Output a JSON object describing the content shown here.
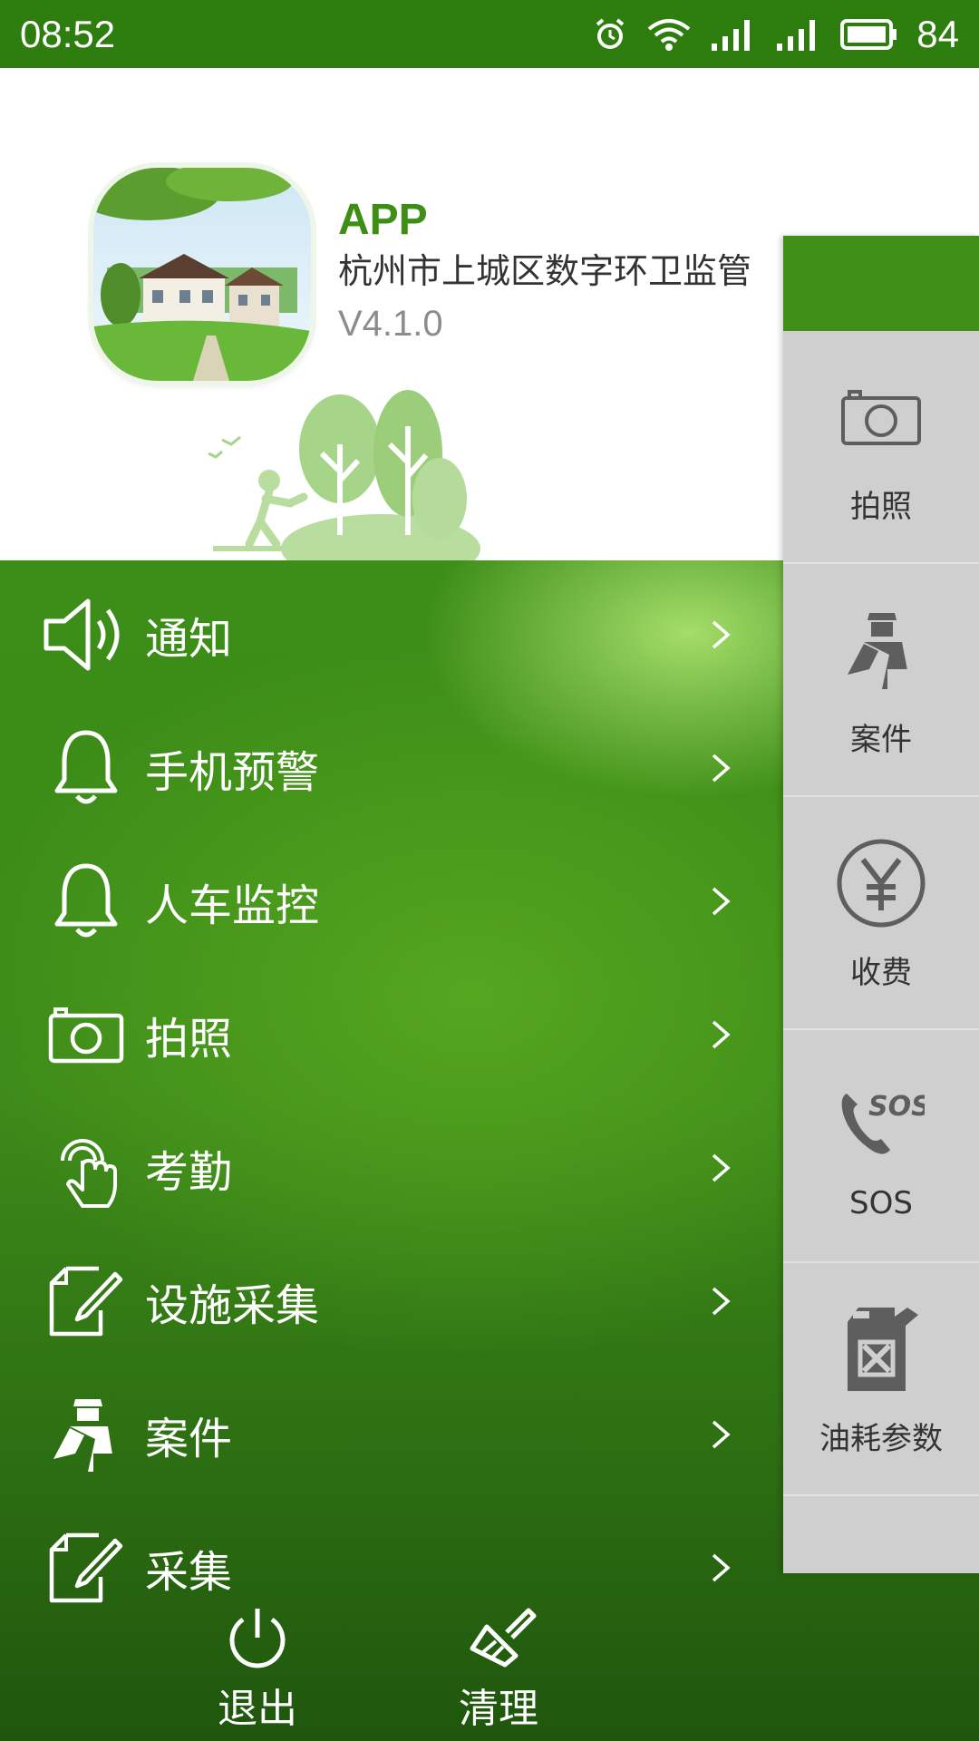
{
  "status_bar": {
    "time": "08:52",
    "battery": "84"
  },
  "app": {
    "name": "APP",
    "org": "杭州市上城区数字环卫监管",
    "version": "V4.1.0"
  },
  "menu": {
    "items": [
      {
        "label": "通知",
        "icon": "speaker-icon"
      },
      {
        "label": "手机预警",
        "icon": "bell-icon"
      },
      {
        "label": "人车监控",
        "icon": "bell-icon"
      },
      {
        "label": "拍照",
        "icon": "camera-icon"
      },
      {
        "label": "考勤",
        "icon": "fingerprint-touch-icon"
      },
      {
        "label": "设施采集",
        "icon": "edit-icon"
      },
      {
        "label": "案件",
        "icon": "officer-icon"
      },
      {
        "label": "采集",
        "icon": "edit-icon"
      }
    ]
  },
  "bottom": {
    "logout_label": "退出",
    "clean_label": "清理"
  },
  "side_panel": {
    "items": [
      {
        "label": "拍照",
        "icon": "camera-icon"
      },
      {
        "label": "案件",
        "icon": "officer-icon"
      },
      {
        "label": "收费",
        "icon": "yen-icon"
      },
      {
        "label": "SOS",
        "icon": "sos-phone-icon"
      },
      {
        "label": "油耗参数",
        "icon": "fuel-can-icon"
      }
    ]
  },
  "colors": {
    "brand_green": "#3f8f17",
    "status_green": "#2e7d0f",
    "panel_gray": "#cfcfcf"
  }
}
